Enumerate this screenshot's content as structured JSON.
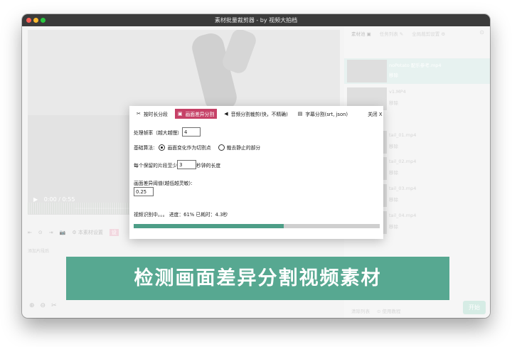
{
  "window": {
    "title": "素材批量裁剪器 - by 视频大拍档"
  },
  "player": {
    "time": "0:00 / 0:55",
    "play_icon": "play-icon"
  },
  "editor_toolbar": {
    "items": [
      "⇤",
      "⊙",
      "⇥",
      "📷",
      "⚙ 本素材设置"
    ],
    "chip": "设"
  },
  "editor_hint": "添加片段后",
  "sidebar": {
    "tabs": [
      "素材池 ▣",
      "任务列表 ✎",
      "全局裁剪设置 ⚙"
    ],
    "videos": [
      {
        "name": "noPotato 配乐参考.mp4",
        "remove": "移除",
        "selected": true
      },
      {
        "name": "v1.MP4",
        "remove": "移除",
        "selected": false
      },
      {
        "name": "tail_01.mp4",
        "remove": "移除",
        "selected": false
      },
      {
        "name": "tail_02.mp4",
        "remove": "移除",
        "selected": false
      },
      {
        "name": "tail_03.mp4",
        "remove": "移除",
        "selected": false
      },
      {
        "name": "tail_04.mp4",
        "remove": "移除",
        "selected": false
      }
    ],
    "bottom_left": "清除列表",
    "bottom_right": "⊙ 使用教程",
    "start": "开始"
  },
  "dialog": {
    "tabs": [
      {
        "icon": "scissors-icon",
        "glyph": "✂",
        "label": "按时长分段",
        "active": false
      },
      {
        "icon": "image-icon",
        "glyph": "▣",
        "label": "画面差异分割",
        "active": true
      },
      {
        "icon": "speaker-icon",
        "glyph": "◀",
        "label": "音频分割裁剪(快，不精确)",
        "active": false
      },
      {
        "icon": "subtitle-icon",
        "glyph": "▤",
        "label": "字幕分割(srt, json)",
        "active": false
      }
    ],
    "close_label": "关闭 X",
    "fps_label": "处理帧率（越大越慢）",
    "fps_value": "4",
    "algo_label": "基础算法:",
    "algo_option_1": "画面变化作为切割点",
    "algo_option_2": "裁去静止的部分",
    "min_len_prefix": "每个保留的片段至少",
    "min_len_value": "3",
    "min_len_suffix": "秒钟的长度",
    "threshold_label": "画面差异阈值(越低越灵敏):",
    "threshold_value": "0.25",
    "status_text": "视频识别中。。。  进度：61%  已耗时：4.3秒",
    "progress": 0.61
  },
  "banner": "检测画面差异分割视频素材",
  "colors": {
    "accent": "#c64167",
    "progress": "#4d9e87",
    "banner": "#57a891"
  }
}
